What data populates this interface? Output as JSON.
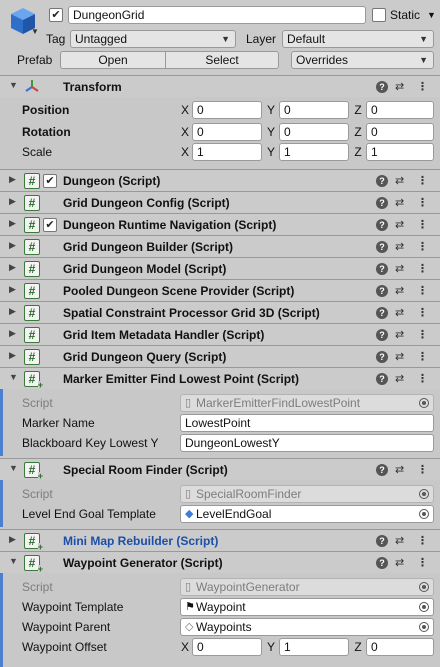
{
  "header": {
    "object_name": "DungeonGrid",
    "active_checked": true,
    "static_label": "Static",
    "static_checked": false,
    "tag_label": "Tag",
    "tag_value": "Untagged",
    "layer_label": "Layer",
    "layer_value": "Default",
    "prefab_label": "Prefab",
    "open_label": "Open",
    "select_label": "Select",
    "overrides_label": "Overrides"
  },
  "transform": {
    "title": "Transform",
    "position_label": "Position",
    "rotation_label": "Rotation",
    "scale_label": "Scale",
    "axis_x": "X",
    "axis_y": "Y",
    "axis_z": "Z",
    "position": {
      "x": "0",
      "y": "0",
      "z": "0"
    },
    "rotation": {
      "x": "0",
      "y": "0",
      "z": "0"
    },
    "scale": {
      "x": "1",
      "y": "1",
      "z": "1"
    }
  },
  "components": [
    {
      "title": "Dungeon (Script)",
      "has_checkbox": true
    },
    {
      "title": "Grid Dungeon Config (Script)",
      "has_checkbox": false
    },
    {
      "title": "Dungeon Runtime Navigation (Script)",
      "has_checkbox": true
    },
    {
      "title": "Grid Dungeon Builder (Script)",
      "has_checkbox": false
    },
    {
      "title": "Grid Dungeon Model (Script)",
      "has_checkbox": false
    },
    {
      "title": "Pooled Dungeon Scene Provider (Script)",
      "has_checkbox": false
    },
    {
      "title": "Spatial Constraint Processor Grid 3D (Script)",
      "has_checkbox": false
    },
    {
      "title": "Grid Item Metadata Handler (Script)",
      "has_checkbox": false
    },
    {
      "title": "Grid Dungeon Query (Script)",
      "has_checkbox": false
    }
  ],
  "marker_emitter": {
    "title": "Marker Emitter Find Lowest Point (Script)",
    "script_label": "Script",
    "script_value": "MarkerEmitterFindLowestPoint",
    "marker_name_label": "Marker Name",
    "marker_name_value": "LowestPoint",
    "blackboard_label": "Blackboard Key Lowest Y",
    "blackboard_value": "DungeonLowestY"
  },
  "special_room": {
    "title": "Special Room Finder (Script)",
    "script_label": "Script",
    "script_value": "SpecialRoomFinder",
    "template_label": "Level End Goal Template",
    "template_value": "LevelEndGoal"
  },
  "minimap": {
    "title": "Mini Map Rebuilder (Script)"
  },
  "waypoint": {
    "title": "Waypoint Generator (Script)",
    "script_label": "Script",
    "script_value": "WaypointGenerator",
    "template_label": "Waypoint Template",
    "template_value": "Waypoint",
    "parent_label": "Waypoint Parent",
    "parent_value": "Waypoints",
    "offset_label": "Waypoint Offset",
    "offset": {
      "x": "0",
      "y": "1",
      "z": "0"
    }
  },
  "icons": {
    "gameobject": "cube-icon",
    "transform": "transform-axes-icon",
    "script": "hash-script-icon",
    "help": "help-icon",
    "presets": "sliders-icon",
    "more": "kebab-menu-icon"
  },
  "colors": {
    "panel": "#c8c8c8",
    "header": "#cbcbcb",
    "selected_bar": "#4a7fd1",
    "link_title": "#1c4fa7",
    "script_icon": "#2a6b2a",
    "cube_blue": "#3c7fd9"
  }
}
